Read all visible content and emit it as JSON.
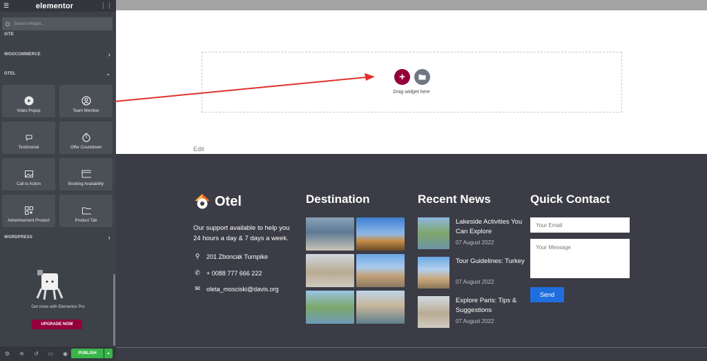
{
  "panel": {
    "brand": "elementor",
    "search_placeholder": "Search Widget...",
    "categories": {
      "site": "SITE",
      "woocommerce": "WOOCOMMERCE",
      "otel": "OTEL",
      "wordpress": "WORDPRESS"
    },
    "widgets": [
      {
        "label": "Video Popup",
        "icon": "play-circle-icon"
      },
      {
        "label": "Team Member",
        "icon": "user-circle-icon"
      },
      {
        "label": "Testimonial",
        "icon": "chat-icon"
      },
      {
        "label": "Offer Countdown",
        "icon": "stopwatch-icon"
      },
      {
        "label": "Call to Action",
        "icon": "image-icon"
      },
      {
        "label": "Booking Availability",
        "icon": "window-icon"
      },
      {
        "label": "Advertisement Product",
        "icon": "qr-icon"
      },
      {
        "label": "Product Tab",
        "icon": "folder-icon"
      }
    ],
    "promo_text": "Get more with Elementor Pro",
    "upgrade_label": "UPGRADE NOW",
    "publish_label": "PUBLISH"
  },
  "canvas": {
    "drop_text": "Drag widget here",
    "edit_label": "Edit"
  },
  "footer": {
    "brand": "Otel",
    "about": "Our support available to help you 24 hours a day & 7 days a week.",
    "address": "201 Zboncak Turnpike",
    "phone": "+ 0088 777 666 222",
    "email": "oleta_mosciski@davis.org",
    "destination_heading": "Destination",
    "news_heading": "Recent News",
    "contact_heading": "Quick Contact",
    "news": [
      {
        "title": "Lakeside Activities You Can Explore",
        "date": "07 August 2022"
      },
      {
        "title": "Tour Guidelines: Turkey",
        "date": "07 August 2022"
      },
      {
        "title": "Explore Paris: Tips & Suggestions",
        "date": "07 August 2022"
      }
    ],
    "email_placeholder": "Your Email",
    "message_placeholder": "Your Message",
    "send_label": "Send"
  },
  "colors": {
    "panel_bg": "#3d4148",
    "accent": "#93003c",
    "publish": "#39b54a",
    "footer_bg": "#3b3c46",
    "send": "#1f6ede"
  }
}
